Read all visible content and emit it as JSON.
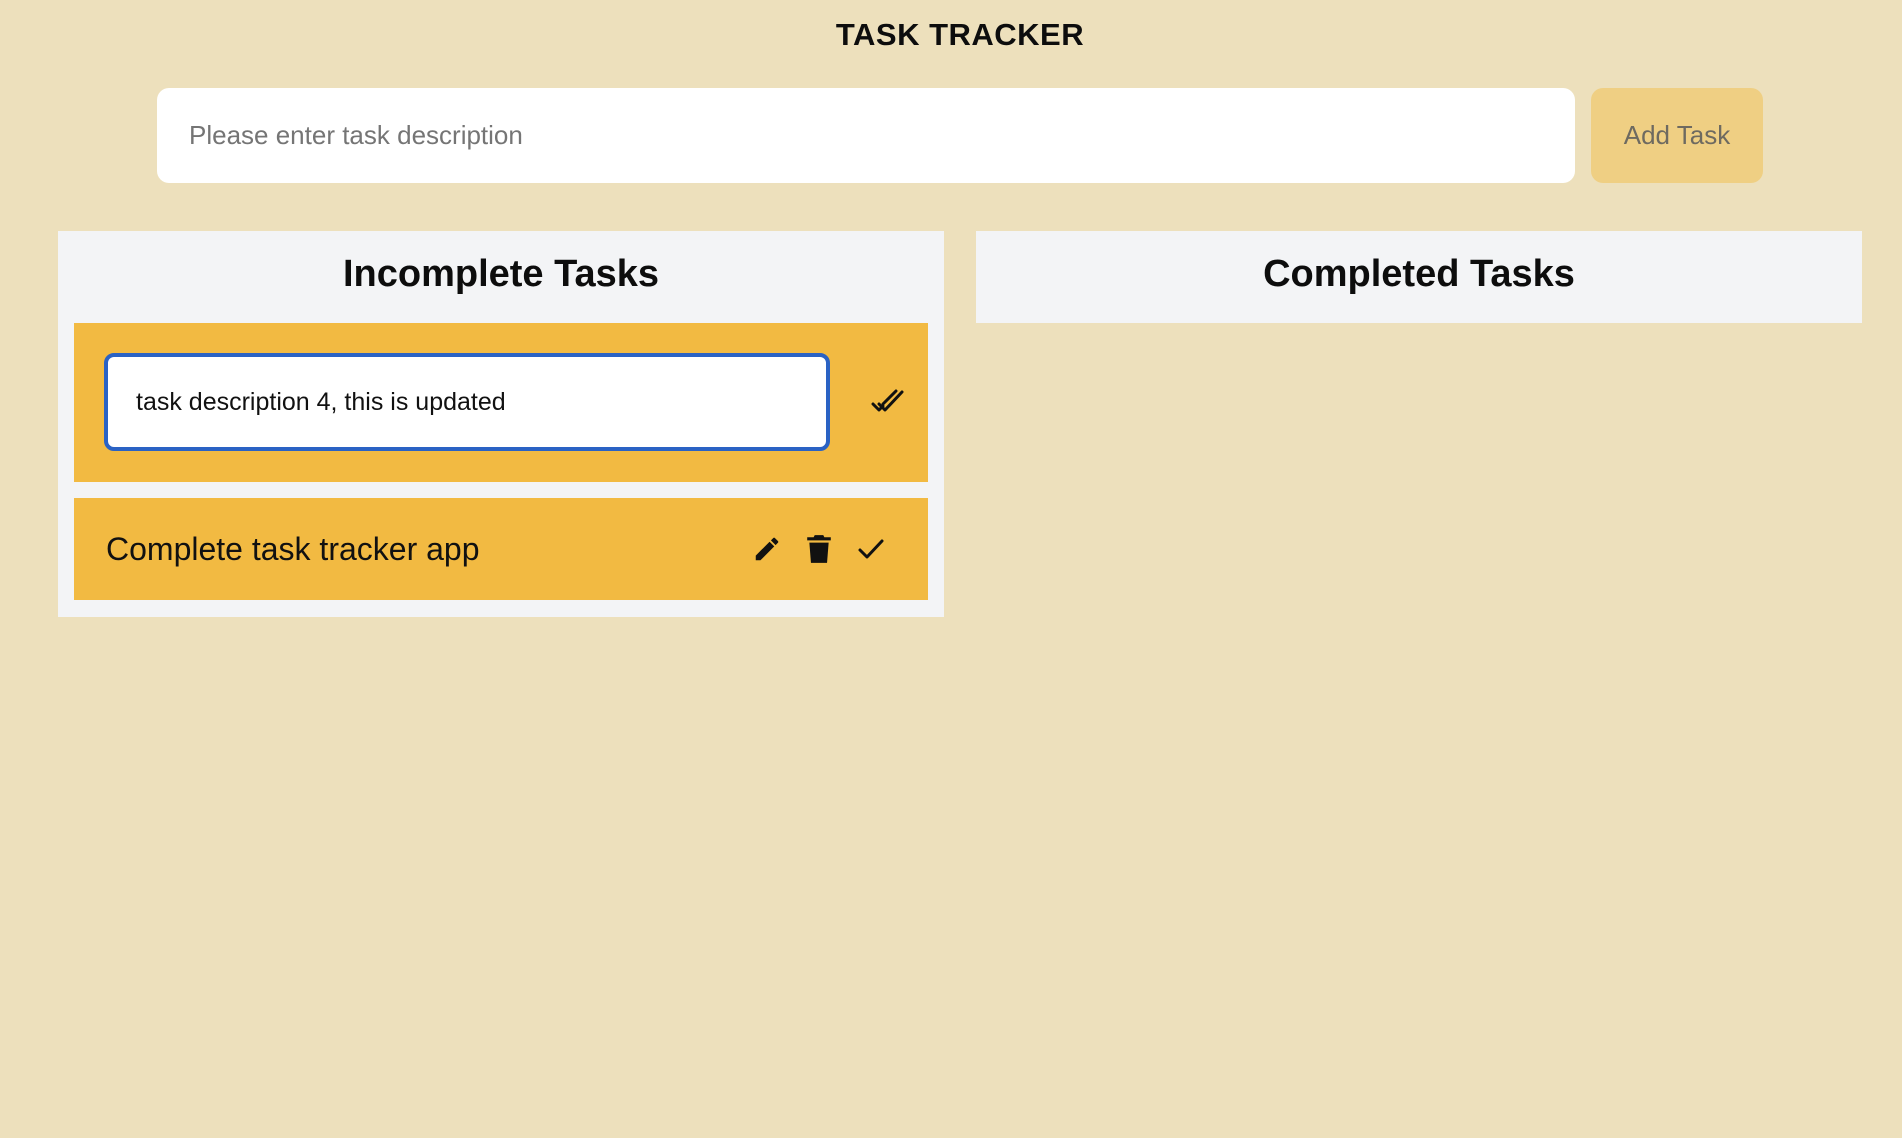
{
  "header": {
    "title": "TASK TRACKER"
  },
  "new_task": {
    "placeholder": "Please enter task description",
    "value": "",
    "add_button_label": "Add Task"
  },
  "incomplete": {
    "heading": "Incomplete Tasks",
    "editing_task": {
      "value": "task description 4, this is updated",
      "save_icon": "double-check-icon"
    },
    "tasks": [
      {
        "text": "Complete task tracker app",
        "icons": [
          "pencil-icon",
          "trash-icon",
          "check-icon"
        ]
      }
    ]
  },
  "completed": {
    "heading": "Completed Tasks",
    "tasks": []
  },
  "colors": {
    "background": "#ede0bc",
    "panel": "#f3f4f6",
    "task_card": "#f2ba42",
    "add_button": "#efcf83",
    "focus_ring": "#2a62c4"
  }
}
